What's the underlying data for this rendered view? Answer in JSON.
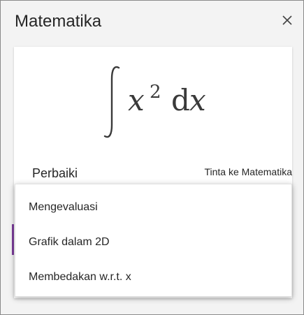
{
  "pane": {
    "title": "Matematika",
    "close_icon": "close-icon"
  },
  "equation": {
    "integral": "∫",
    "variable": "x",
    "exponent": "2",
    "differential": "d",
    "diff_variable": "x"
  },
  "card": {
    "fix_label": "Perbaiki",
    "ink_link": "Tinta ke Matematika"
  },
  "menu": {
    "items": [
      {
        "label": "Mengevaluasi"
      },
      {
        "label": "Grafik dalam 2D"
      },
      {
        "label": "Membedakan w.r.t. x"
      }
    ]
  },
  "colors": {
    "accent": "#7a3c9a",
    "pane_background": "#f3f3f3",
    "card_background": "#ffffff",
    "text": "#262626"
  }
}
